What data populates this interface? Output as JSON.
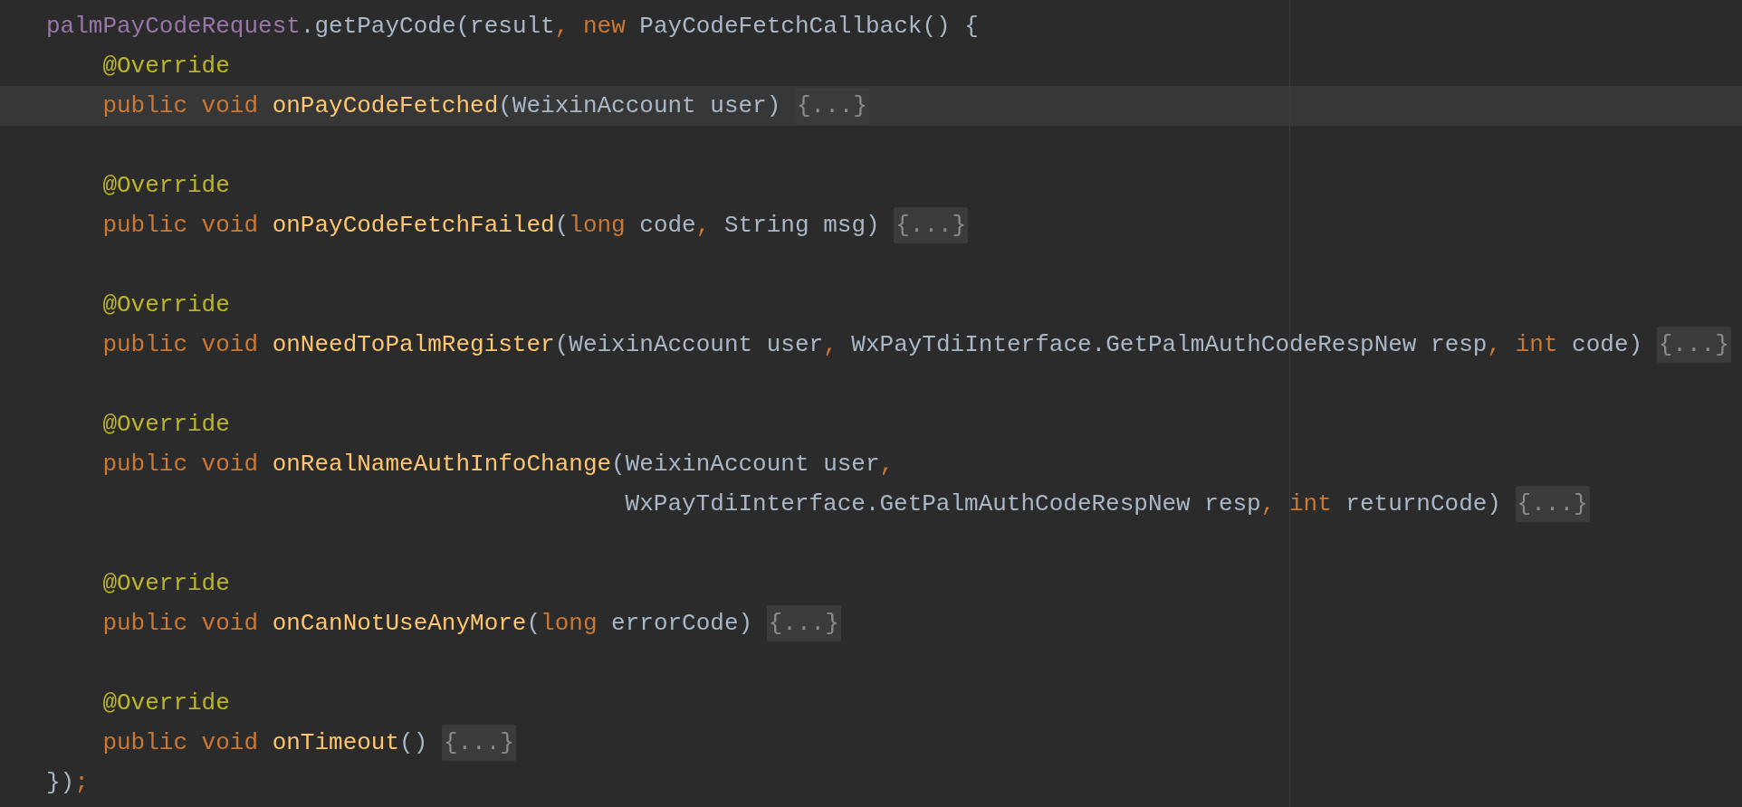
{
  "lines": [
    {
      "current": false,
      "kind": "statement",
      "tokens": [
        {
          "kind": "field",
          "text": "palmPayCodeRequest"
        },
        {
          "kind": "plain",
          "text": ".getPayCode(result"
        },
        {
          "kind": "keyword",
          "text": ", new "
        },
        {
          "kind": "plain",
          "text": "PayCodeFetchCallback() {"
        }
      ]
    },
    {
      "current": false,
      "kind": "member",
      "tokens": [
        {
          "kind": "annotation",
          "text": "@Override"
        }
      ]
    },
    {
      "current": true,
      "kind": "member",
      "tokens": [
        {
          "kind": "keyword",
          "text": "public void "
        },
        {
          "kind": "method",
          "text": "onPayCodeFetched"
        },
        {
          "kind": "plain",
          "text": "(WeixinAccount user) "
        }
      ],
      "fold": "{...}"
    },
    {
      "current": false,
      "kind": "blank"
    },
    {
      "current": false,
      "kind": "member",
      "tokens": [
        {
          "kind": "annotation",
          "text": "@Override"
        }
      ]
    },
    {
      "current": false,
      "kind": "member",
      "tokens": [
        {
          "kind": "keyword",
          "text": "public void "
        },
        {
          "kind": "method",
          "text": "onPayCodeFetchFailed"
        },
        {
          "kind": "plain",
          "text": "("
        },
        {
          "kind": "keyword",
          "text": "long "
        },
        {
          "kind": "plain",
          "text": "code"
        },
        {
          "kind": "keyword",
          "text": ", "
        },
        {
          "kind": "plain",
          "text": "String msg) "
        }
      ],
      "fold": "{...}"
    },
    {
      "current": false,
      "kind": "blank"
    },
    {
      "current": false,
      "kind": "member",
      "tokens": [
        {
          "kind": "annotation",
          "text": "@Override"
        }
      ]
    },
    {
      "current": false,
      "kind": "member",
      "tokens": [
        {
          "kind": "keyword",
          "text": "public void "
        },
        {
          "kind": "method",
          "text": "onNeedToPalmRegister"
        },
        {
          "kind": "plain",
          "text": "(WeixinAccount user"
        },
        {
          "kind": "keyword",
          "text": ", "
        },
        {
          "kind": "plain",
          "text": "WxPayTdiInterface.GetPalmAuthCodeRespNew resp"
        },
        {
          "kind": "keyword",
          "text": ", int "
        },
        {
          "kind": "plain",
          "text": "code) "
        }
      ],
      "fold": "{...}"
    },
    {
      "current": false,
      "kind": "blank"
    },
    {
      "current": false,
      "kind": "member",
      "tokens": [
        {
          "kind": "annotation",
          "text": "@Override"
        }
      ]
    },
    {
      "current": false,
      "kind": "member",
      "tokens": [
        {
          "kind": "keyword",
          "text": "public void "
        },
        {
          "kind": "method",
          "text": "onRealNameAuthInfoChange"
        },
        {
          "kind": "plain",
          "text": "(WeixinAccount user"
        },
        {
          "kind": "keyword",
          "text": ","
        }
      ]
    },
    {
      "current": false,
      "kind": "continuation",
      "tokens": [
        {
          "kind": "plain",
          "text": "WxPayTdiInterface.GetPalmAuthCodeRespNew resp"
        },
        {
          "kind": "keyword",
          "text": ", int "
        },
        {
          "kind": "plain",
          "text": "returnCode) "
        }
      ],
      "fold": "{...}"
    },
    {
      "current": false,
      "kind": "blank"
    },
    {
      "current": false,
      "kind": "member",
      "tokens": [
        {
          "kind": "annotation",
          "text": "@Override"
        }
      ]
    },
    {
      "current": false,
      "kind": "member",
      "tokens": [
        {
          "kind": "keyword",
          "text": "public void "
        },
        {
          "kind": "method",
          "text": "onCanNotUseAnyMore"
        },
        {
          "kind": "plain",
          "text": "("
        },
        {
          "kind": "keyword",
          "text": "long "
        },
        {
          "kind": "plain",
          "text": "errorCode) "
        }
      ],
      "fold": "{...}"
    },
    {
      "current": false,
      "kind": "blank"
    },
    {
      "current": false,
      "kind": "member",
      "tokens": [
        {
          "kind": "annotation",
          "text": "@Override"
        }
      ]
    },
    {
      "current": false,
      "kind": "member",
      "tokens": [
        {
          "kind": "keyword",
          "text": "public void "
        },
        {
          "kind": "method",
          "text": "onTimeout"
        },
        {
          "kind": "plain",
          "text": "() "
        }
      ],
      "fold": "{...}"
    },
    {
      "current": false,
      "kind": "statement",
      "tokens": [
        {
          "kind": "plain",
          "text": "})"
        },
        {
          "kind": "keyword",
          "text": ";"
        }
      ]
    }
  ]
}
